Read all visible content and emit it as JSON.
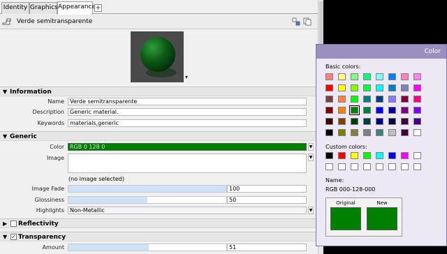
{
  "tabs": [
    {
      "label": "Identity",
      "active": false
    },
    {
      "label": "Graphics",
      "active": false
    },
    {
      "label": "Appearance",
      "active": true
    }
  ],
  "tab_add_label": "+",
  "material": {
    "name": "Verde semitransparente"
  },
  "sections": {
    "information": {
      "title": "Information",
      "fields": {
        "name": {
          "label": "Name",
          "value": "Verde semitransparente"
        },
        "description": {
          "label": "Description",
          "value": "Generic material."
        },
        "keywords": {
          "label": "Keywords",
          "value": "materials,generic"
        }
      }
    },
    "generic": {
      "title": "Generic",
      "color": {
        "label": "Color",
        "value": "RGB 0 128 0",
        "hex": "#008000"
      },
      "image": {
        "label": "Image",
        "note": "(no image selected)"
      },
      "image_fade": {
        "label": "Image Fade",
        "value": "100",
        "level_fraction": 1.0
      },
      "glossiness": {
        "label": "Glossiness",
        "value": "50",
        "level_fraction": 0.5
      },
      "highlights": {
        "label": "Highlights",
        "value": "Non-Metallic"
      }
    },
    "reflectivity": {
      "title": "Reflectivity",
      "checked": false
    },
    "transparency": {
      "title": "Transparency",
      "checked": true,
      "amount": {
        "label": "Amount",
        "value": "51",
        "level_fraction": 0.51
      }
    }
  },
  "color_dialog": {
    "title": "Color",
    "basic_label": "Basic colors:",
    "custom_label": "Custom colors:",
    "name_label": "Name:",
    "name_value": "RGB 000-128-000",
    "original_label": "Original",
    "new_label": "New",
    "selected_hex": "#008000",
    "basic_colors": [
      [
        "#ff8080",
        "#ffff80",
        "#80ff80",
        "#00ff80",
        "#80ffff",
        "#0080ff",
        "#ff80c0",
        "#ff80ff"
      ],
      [
        "#ff0000",
        "#ffff00",
        "#80ff00",
        "#00ff40",
        "#00ffff",
        "#0080c0",
        "#8080c0",
        "#ff00ff"
      ],
      [
        "#804040",
        "#ff8040",
        "#00ff00",
        "#008080",
        "#004080",
        "#8080ff",
        "#800040",
        "#ff0080"
      ],
      [
        "#800000",
        "#ff8000",
        "#008000",
        "#008040",
        "#0000ff",
        "#0000a0",
        "#800080",
        "#8000ff"
      ],
      [
        "#400000",
        "#804000",
        "#004000",
        "#004040",
        "#000080",
        "#000040",
        "#400040",
        "#400080"
      ],
      [
        "#000000",
        "#808000",
        "#808040",
        "#808080",
        "#408080",
        "#c0c0c0",
        "#400040",
        "#ffffff"
      ]
    ],
    "custom_colors": [
      [
        "#000000",
        "#ff0000",
        "#ffff00",
        "#00ff00",
        "#00ffff",
        "#0000ff",
        "#ff00ff",
        "#ffffff"
      ],
      [
        "#ffffff",
        "#ffffff",
        "#ffffff",
        "#ffffff",
        "#ffffff",
        "#ffffff",
        "#ffffff",
        "#ffffff"
      ]
    ],
    "selected_index": [
      3,
      2
    ]
  },
  "colors": {
    "accent_green": "#008000",
    "dialog_title": "#9b8fc0",
    "slider_fill": "#cde2f6"
  }
}
